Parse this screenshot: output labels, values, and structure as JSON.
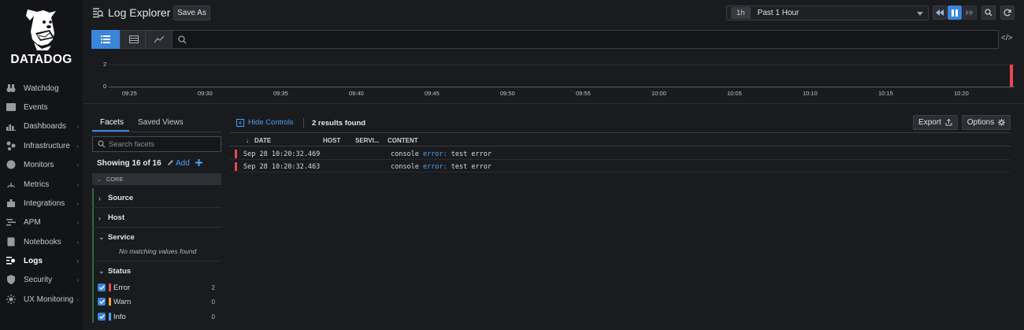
{
  "brand": {
    "name": "DATADOG"
  },
  "nav": {
    "items": [
      {
        "label": "Watchdog",
        "icon": "binoculars-icon",
        "chevron": false
      },
      {
        "label": "Events",
        "icon": "events-icon",
        "chevron": false
      },
      {
        "label": "Dashboards",
        "icon": "dashboard-icon",
        "chevron": true
      },
      {
        "label": "Infrastructure",
        "icon": "infrastructure-icon",
        "chevron": true
      },
      {
        "label": "Monitors",
        "icon": "monitor-icon",
        "chevron": true
      },
      {
        "label": "Metrics",
        "icon": "metrics-icon",
        "chevron": true
      },
      {
        "label": "Integrations",
        "icon": "puzzle-icon",
        "chevron": true
      },
      {
        "label": "APM",
        "icon": "apm-icon",
        "chevron": true
      },
      {
        "label": "Notebooks",
        "icon": "notebook-icon",
        "chevron": true
      },
      {
        "label": "Logs",
        "icon": "logs-icon",
        "chevron": true,
        "active": true
      },
      {
        "label": "Security",
        "icon": "shield-icon",
        "chevron": true
      },
      {
        "label": "UX Monitoring",
        "icon": "ux-icon",
        "chevron": true
      }
    ]
  },
  "header": {
    "title": "Log Explorer",
    "save_as": "Save As",
    "time_badge": "1h",
    "time_range": "Past 1 Hour"
  },
  "search": {
    "placeholder": "",
    "code_toggle": "</>"
  },
  "chart_data": {
    "type": "bar",
    "y_ticks": [
      "2",
      "0"
    ],
    "x_ticks": [
      "09:25",
      "09:30",
      "09:35",
      "09:40",
      "09:45",
      "09:50",
      "09:55",
      "10:00",
      "10:05",
      "10:10",
      "10:15",
      "10:20"
    ],
    "bars": [
      {
        "x": "10:20",
        "value": 2
      }
    ],
    "ylim": [
      0,
      2
    ],
    "colors": {
      "bar": "#e8484d"
    }
  },
  "facets": {
    "tabs": [
      "Facets",
      "Saved Views"
    ],
    "search_placeholder": "Search facets",
    "showing": "Showing 16 of 16",
    "add_label": "Add",
    "core_label": "CORE",
    "groups": [
      {
        "name": "Source",
        "expanded": false
      },
      {
        "name": "Host",
        "expanded": false
      },
      {
        "name": "Service",
        "expanded": true,
        "empty_text": "No matching values found"
      },
      {
        "name": "Status",
        "expanded": true
      }
    ],
    "status_values": [
      {
        "label": "Error",
        "count": "2",
        "color": "#e8484d"
      },
      {
        "label": "Warn",
        "count": "0",
        "color": "#f0a030"
      },
      {
        "label": "Info",
        "count": "0",
        "color": "#4aa0f0"
      }
    ]
  },
  "results": {
    "hide_controls": "Hide Controls",
    "count_text": "2 results found",
    "export_label": "Export",
    "options_label": "Options",
    "columns": [
      "DATE",
      "HOST",
      "SERVI...",
      "CONTENT"
    ],
    "rows": [
      {
        "date": "Sep 28 10:20:32.469",
        "content_prefix": "console",
        "content_level": "error:",
        "content_msg": "test error"
      },
      {
        "date": "Sep 28 10:20:32.463",
        "content_prefix": "console",
        "content_level": "error:",
        "content_msg": "test error"
      }
    ]
  }
}
